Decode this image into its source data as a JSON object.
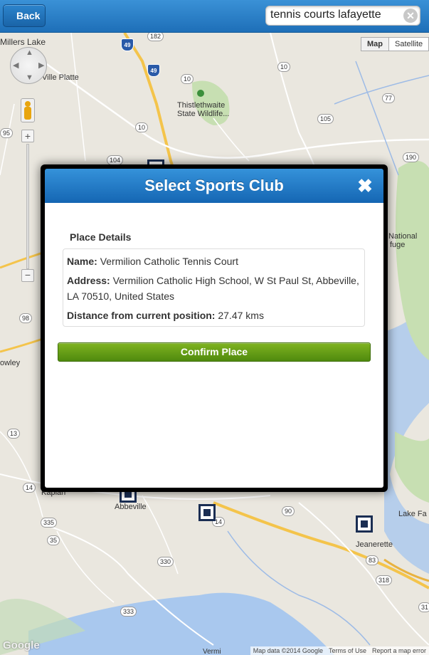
{
  "header": {
    "back_label": "Back",
    "search_value": "tennis courts lafayette",
    "clear_icon": "clear-x-icon"
  },
  "map": {
    "type_buttons": [
      "Map",
      "Satellite"
    ],
    "selected_type": "Map",
    "place_labels": {
      "millers_lake": "Millers Lake",
      "ville_platte": "Ville Platte",
      "thistlethwaite": "Thistlethwaite",
      "state_wildlife": "State Wildlife...",
      "rowley": "owley",
      "kaplan": "Kaplan",
      "abbeville": "Abbeville",
      "jeanerette": "Jeanerette",
      "national": "National",
      "refuge": "fuge",
      "lake_fa": "Lake Fa",
      "vermi": "Vermi"
    },
    "route_shields": {
      "r182": "182",
      "r10a": "10",
      "r10b": "10",
      "r10c": "10",
      "r10d": "10",
      "r77": "77",
      "r105": "105",
      "r95": "95",
      "r190": "190",
      "r104": "104",
      "r98": "98",
      "r13": "13",
      "r14a": "14",
      "r14b": "14",
      "r335": "335",
      "r35": "35",
      "r330": "330",
      "r90": "90",
      "r318": "318",
      "r83": "83",
      "r333": "333",
      "r31": "31"
    },
    "interstates": {
      "i49a": "49",
      "i49b": "49"
    },
    "google_logo": "Google",
    "attribution": [
      "Map data ©2014 Google",
      "Terms of Use",
      "Report a map error"
    ]
  },
  "dialog": {
    "title": "Select Sports Club",
    "close_icon": "close-x-icon",
    "details_heading": "Place Details",
    "name_label": "Name:",
    "name_value": "Vermilion Catholic Tennis Court",
    "address_label": "Address:",
    "address_value": "Vermilion Catholic High School, W St Paul St, Abbeville, LA 70510, United States",
    "distance_label": "Distance from current position:",
    "distance_value": "27.47 kms",
    "confirm_label": "Confirm Place"
  },
  "colors": {
    "header_blue": "#1e6fb8",
    "confirm_green": "#5f9a12",
    "marker_navy": "#1b2e53"
  }
}
